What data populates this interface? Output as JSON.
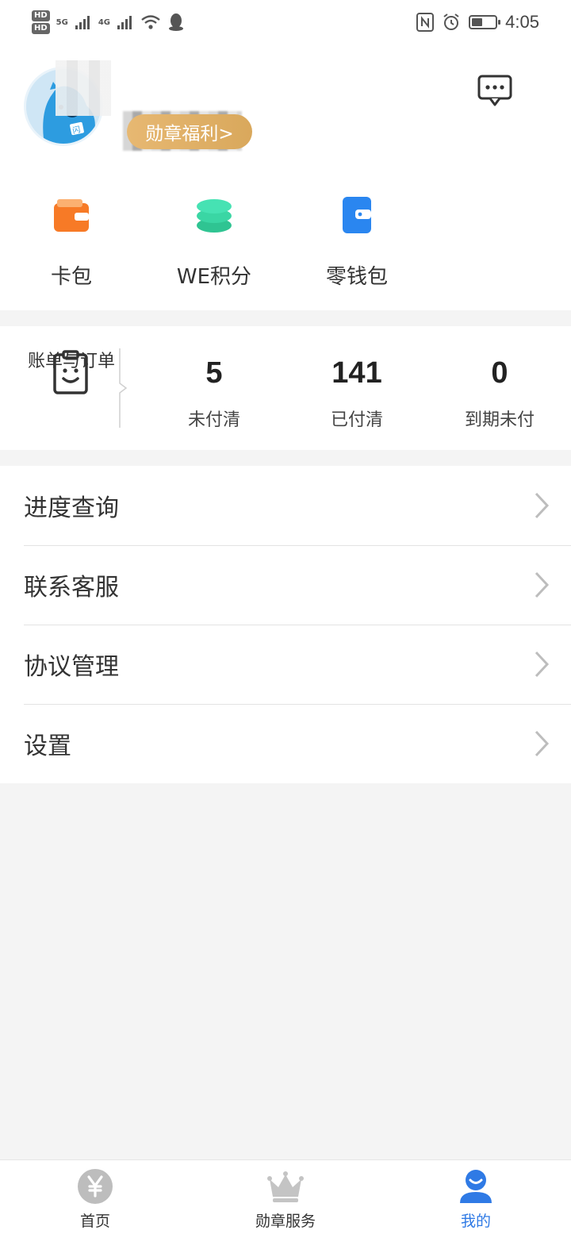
{
  "status_bar": {
    "hd1": "HD",
    "hd2": "HD",
    "net1": "5G",
    "net2": "4G",
    "time": "4:05",
    "battery_level": 0.45
  },
  "profile": {
    "badge_button_label": "勋章福利>"
  },
  "quick_links": [
    {
      "label": "卡包",
      "icon": "wallet-icon"
    },
    {
      "label": "WE积分",
      "icon": "coins-stack-icon"
    },
    {
      "label": "零钱包",
      "icon": "purse-icon"
    }
  ],
  "bills": {
    "main_label": "账单与订单",
    "stats": [
      {
        "value": "5",
        "label": "未付清"
      },
      {
        "value": "141",
        "label": "已付清"
      },
      {
        "value": "0",
        "label": "到期未付"
      }
    ]
  },
  "menu": [
    {
      "label": "进度查询"
    },
    {
      "label": "联系客服"
    },
    {
      "label": "协议管理"
    },
    {
      "label": "设置"
    }
  ],
  "bottom_nav": [
    {
      "label": "首页",
      "icon": "yen-icon"
    },
    {
      "label": "勋章服务",
      "icon": "crown-icon"
    },
    {
      "label": "我的",
      "icon": "user-icon",
      "active": true
    }
  ],
  "colors": {
    "accent_blue": "#2f7ae5",
    "badge_gold": "#e0b066",
    "wallet_orange": "#f77a26",
    "coins_green": "#2fd2a0",
    "purse_blue": "#2a86f0"
  }
}
